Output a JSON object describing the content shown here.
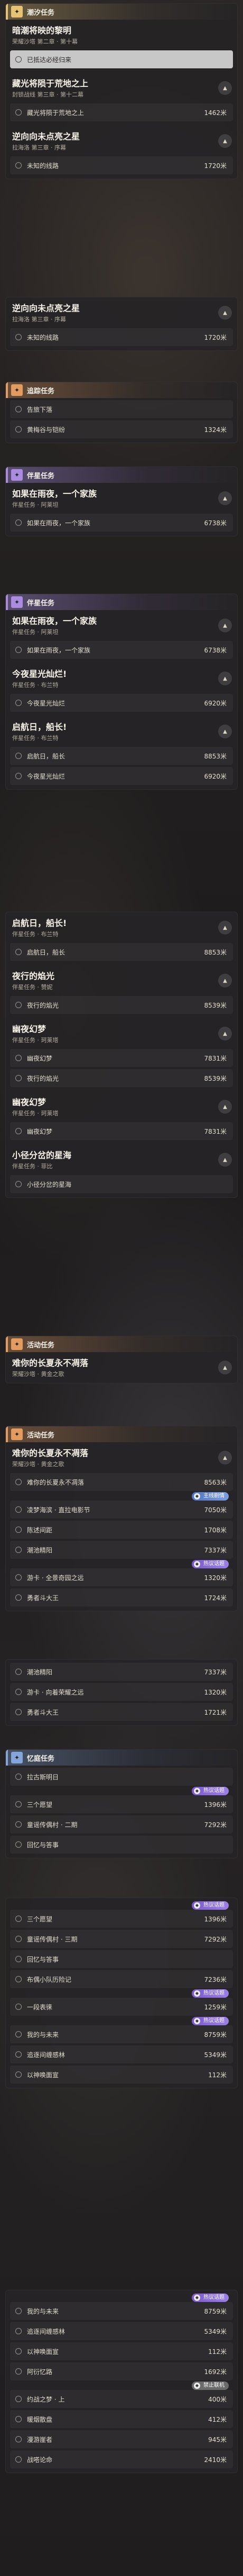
{
  "sections": {
    "tide_trial": "潮汐任务",
    "trailblaze": "追踪任务",
    "companion": "伴星任务",
    "event": "活动任务",
    "memory": "忆庭任务"
  },
  "quests": {
    "q1": {
      "title": "暗潮将映的黎明",
      "sub": "荣耀沙塔 第二章 · 第十幕",
      "rows": [
        {
          "text": "已抵达必经归来",
          "dist": ""
        }
      ]
    },
    "q2": {
      "title": "藏光将陨于荒地之上",
      "sub": "封锁战线 第三章 · 第十二幕",
      "rows": [
        {
          "text": "藏光将陨于荒地之上",
          "dist": "1462米"
        }
      ]
    },
    "q3": {
      "title": "逆向向未点亮之星",
      "sub": "拉海洛 第三章 · 序幕",
      "rows": [
        {
          "text": "未知的线路",
          "dist": "1720米"
        }
      ]
    },
    "q4": {
      "title": "逆向向未点亮之星",
      "sub": "拉海洛 第三章 · 序幕",
      "rows": [
        {
          "text": "未知的线路",
          "dist": "1720米"
        }
      ]
    },
    "q5": {
      "title": "",
      "sub": "",
      "rows": [
        {
          "text": "告旅下落",
          "dist": ""
        },
        {
          "text": "黄梅谷与铠纷",
          "dist": "1324米"
        }
      ]
    },
    "q6": {
      "title": "如果在雨夜，一个家族",
      "sub": "伴星任务 · 阿莱坦",
      "rows": [
        {
          "text": "如果在雨夜，一个家族",
          "dist": "6738米"
        }
      ]
    },
    "q7": {
      "title": "如果在雨夜，一个家族",
      "sub": "伴星任务 · 阿莱坦",
      "rows": [
        {
          "text": "如果在雨夜，一个家族",
          "dist": "6738米"
        }
      ]
    },
    "q8": {
      "title": "今夜星光灿烂!",
      "sub": "伴星任务 · 布兰特",
      "rows": [
        {
          "text": "今夜星光灿烂",
          "dist": "6920米"
        }
      ]
    },
    "q9": {
      "title": "启航日，船长!",
      "sub": "伴星任务 · 布兰特",
      "rows": [
        {
          "text": "启航日，船长",
          "dist": "8853米"
        },
        {
          "text": "今夜星光灿烂",
          "dist": "6920米"
        }
      ]
    },
    "q10": {
      "title": "启航日，船长!",
      "sub": "伴星任务 · 布兰特",
      "rows": [
        {
          "text": "启航日，船长",
          "dist": "8853米"
        }
      ]
    },
    "q11": {
      "title": "夜行的焰光",
      "sub": "伴星任务 · 赞妮",
      "rows": [
        {
          "text": "夜行的焰光",
          "dist": "8539米"
        }
      ]
    },
    "q12": {
      "title": "幽夜幻梦",
      "sub": "伴星任务 · 珂莱塔",
      "rows": [
        {
          "text": "幽夜幻梦",
          "dist": "7831米"
        },
        {
          "text": "夜行的焰光",
          "dist": "8539米"
        }
      ]
    },
    "q13": {
      "title": "幽夜幻梦",
      "sub": "伴星任务 · 珂莱塔",
      "rows": [
        {
          "text": "幽夜幻梦",
          "dist": "7831米"
        }
      ]
    },
    "q14": {
      "title": "小径分岔的星海",
      "sub": "伴星任务 · 菲比",
      "rows": [
        {
          "text": "小径分岔的星海",
          "dist": ""
        }
      ]
    },
    "q15": {
      "title": "难你的长夏永不凋落",
      "sub": "荣耀沙塔 · 黄金之歌",
      "rows": []
    },
    "q16": {
      "title": "难你的长夏永不凋落",
      "sub": "荣耀沙塔 · 黄金之歌",
      "rows": [
        {
          "text": "难你的长夏永不凋落",
          "dist": "8563米"
        },
        {
          "text": "凌梦海滨 · 直拉电影节",
          "dist": "7050米"
        },
        {
          "text": "陈述间距",
          "dist": "1708米"
        },
        {
          "text": "潮池精阳",
          "dist": "7337米"
        },
        {
          "text": "游卡 · 全景奇园之远",
          "dist": "1320米"
        },
        {
          "text": "勇者斗大王",
          "dist": "1724米"
        }
      ]
    },
    "q17": {
      "title": "",
      "sub": "",
      "rows": [
        {
          "text": "潮池精阳",
          "dist": "7337米"
        },
        {
          "text": "游卡 · 向着荣耀之远",
          "dist": "1320米"
        },
        {
          "text": "勇者斗大王",
          "dist": "1721米"
        }
      ]
    },
    "q18": {
      "title": "",
      "sub": "",
      "rows": [
        {
          "text": "拉古斯明日",
          "dist": ""
        },
        {
          "text": "三个愿望",
          "dist": "1396米"
        },
        {
          "text": "童谣传偶村 · 二期",
          "dist": "7292米"
        },
        {
          "text": "回忆与答事",
          "dist": ""
        }
      ]
    },
    "q19": {
      "title": "",
      "sub": "",
      "rows": [
        {
          "text": "三个愿望",
          "dist": "1396米"
        },
        {
          "text": "童谣传偶村 · 三期",
          "dist": "7292米"
        },
        {
          "text": "回忆与答事",
          "dist": ""
        },
        {
          "text": "布偶小队历险记",
          "dist": "7236米"
        },
        {
          "text": "一段表徕",
          "dist": "1259米"
        },
        {
          "text": "我的与未来",
          "dist": "8759米"
        },
        {
          "text": "追逐间缠感林",
          "dist": "5349米"
        },
        {
          "text": "以神唤面宣",
          "dist": "112米"
        }
      ]
    },
    "q20": {
      "title": "",
      "sub": "",
      "rows": [
        {
          "text": "我的与未来",
          "dist": "8759米"
        },
        {
          "text": "追逐间缠感林",
          "dist": "5349米"
        },
        {
          "text": "以神唤面宣",
          "dist": "112米"
        },
        {
          "text": "阿衍忆路",
          "dist": "1692米"
        },
        {
          "text": "约战之梦 · 上",
          "dist": "400米"
        },
        {
          "text": "暖烟散盘",
          "dist": "412米"
        },
        {
          "text": "漫游崖者",
          "dist": "945米"
        },
        {
          "text": "战嗒论命",
          "dist": "2410米"
        }
      ]
    }
  },
  "tags": {
    "main_story": "主线剧情",
    "hot_talk": "热议话题",
    "new_arrival": "限时活动",
    "offline": "禁止联机"
  },
  "icons": {
    "collapse": "chevron-up-icon",
    "quest": "quest-marker-icon",
    "check": "check-icon"
  },
  "colors": {
    "gold": "#e6c373",
    "orange": "#e39b60",
    "purple": "#a98be0",
    "blue": "#84a5d9"
  }
}
